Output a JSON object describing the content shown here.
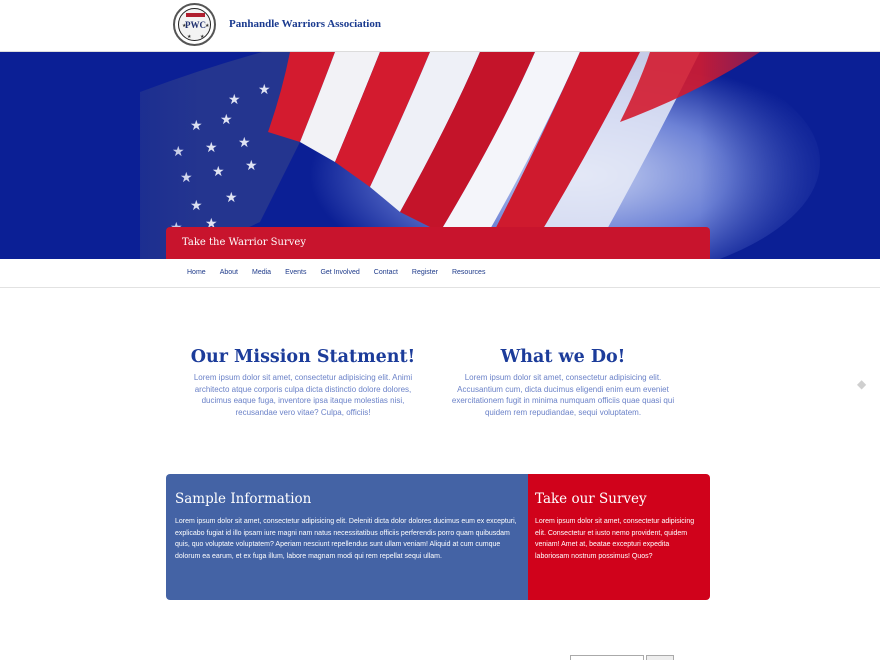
{
  "header": {
    "logo_text": "PWC",
    "site_title": "Panhandle Warriors Association"
  },
  "hero": {
    "banner_label": "Take the Warrior Survey"
  },
  "nav": {
    "items": [
      "Home",
      "About",
      "Media",
      "Events",
      "Get Involved",
      "Contact",
      "Register",
      "Resources"
    ]
  },
  "mission": {
    "title": "Our Mission Statment!",
    "body": "Lorem ipsum dolor sit amet, consectetur adipisicing elit. Animi architecto atque corporis culpa dicta distinctio dolore dolores, ducimus eaque fuga, inventore ipsa itaque molestias nisi, recusandae vero vitae? Culpa, officiis!"
  },
  "what_we_do": {
    "title": "What we Do!",
    "body": "Lorem ipsum dolor sit amet, consectetur adipisicing elit. Accusantium cum, dicta ducimus eligendi enim eum eveniet exercitationem fugit in minima numquam officiis quae quasi qui quidem rem repudiandae, sequi voluptatem."
  },
  "sample_info": {
    "title": "Sample Information",
    "body": "Lorem ipsum dolor sit amet, consectetur adipisicing elit. Deleniti dicta dolor dolores ducimus eum ex excepturi, explicabo fugiat id illo ipsam iure magni nam natus necessitatibus officiis perferendis porro quam quibusdam quis, quo voluptate voluptatem? Aperiam nesciunt repellendus sunt ullam veniam! Aliquid at cum cumque dolorum ea earum, et ex fuga illum, labore magnam modi qui rem repellat sequi ullam."
  },
  "take_survey": {
    "title": "Take our Survey",
    "body": "Lorem ipsum dolor sit amet, consectetur adipisicing elit. Consectetur et iusto nemo provident, quidem veniam! Amet at, beatae excepturi expedita laboriosam nostrum possimus! Quos?"
  },
  "colors": {
    "brand_blue": "#1c3c9a",
    "hero_blue": "#0b1f95",
    "banner_red": "#c8142d",
    "box_blue": "#4463a5",
    "box_red": "#d0021b"
  },
  "icons": {
    "scroll_arrow": "diamond-arrow-icon"
  }
}
